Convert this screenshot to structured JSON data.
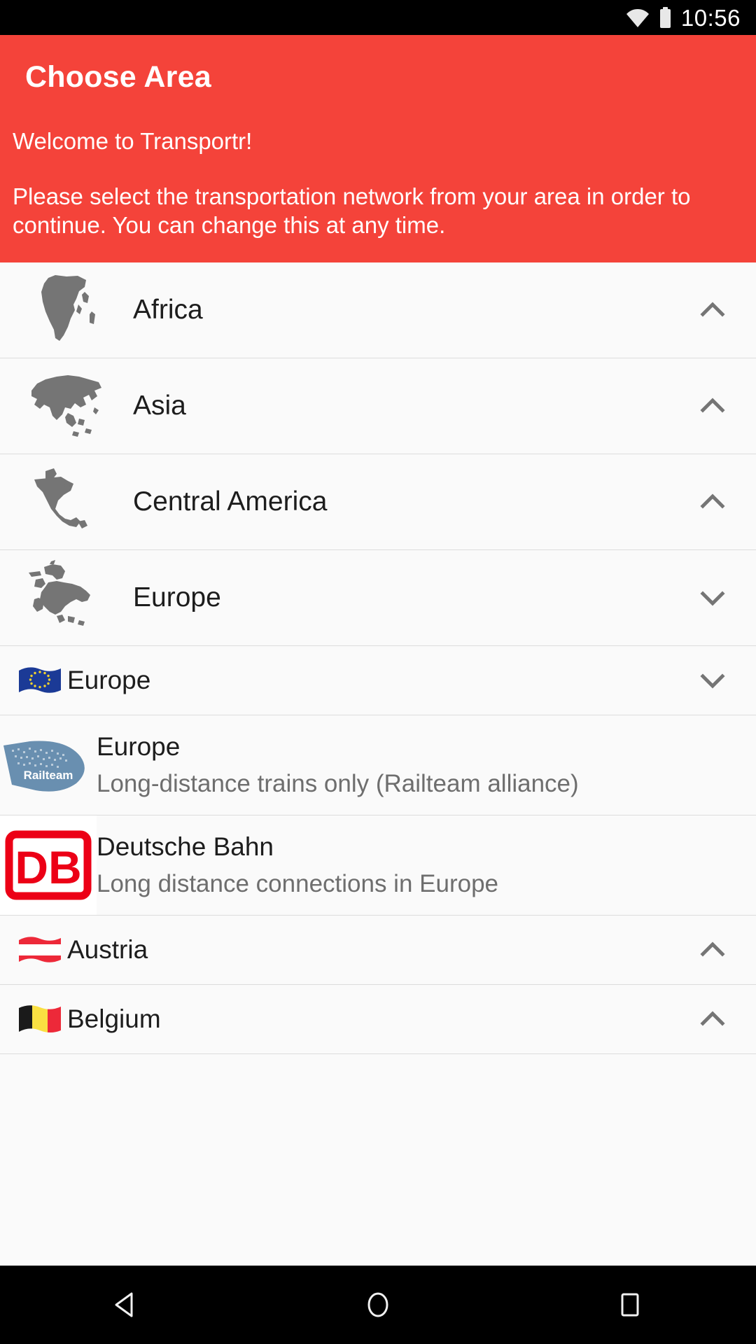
{
  "statusbar": {
    "time": "10:56",
    "icons": [
      "wifi-icon",
      "battery-icon"
    ]
  },
  "header": {
    "title": "Choose Area",
    "welcome": "Welcome to Transportr!",
    "instructions": "Please select the transportation network from your area in order to continue. You can change this at any time.",
    "background_color": "#f4433a",
    "text_color": "#ffffff"
  },
  "list": {
    "rows": [
      {
        "kind": "continent",
        "icon": "africa-map-icon",
        "label": "Africa",
        "chevron": "chevron-up-icon"
      },
      {
        "kind": "continent",
        "icon": "asia-map-icon",
        "label": "Asia",
        "chevron": "chevron-up-icon"
      },
      {
        "kind": "continent",
        "icon": "central-america-map-icon",
        "label": "Central America",
        "chevron": "chevron-up-icon"
      },
      {
        "kind": "continent",
        "icon": "europe-map-icon",
        "label": "Europe",
        "chevron": "chevron-down-icon"
      },
      {
        "kind": "country",
        "icon": "flag-european-union-icon",
        "label": "Europe",
        "chevron": "chevron-down-icon"
      },
      {
        "kind": "provider",
        "icon": "railteam-logo",
        "name": "Europe",
        "desc": "Long-distance trains only (Railteam alliance)"
      },
      {
        "kind": "provider",
        "icon": "deutsche-bahn-logo",
        "name": "Deutsche Bahn",
        "desc": "Long distance connections in Europe"
      },
      {
        "kind": "country",
        "icon": "flag-austria-icon",
        "label": "Austria",
        "chevron": "chevron-up-icon"
      },
      {
        "kind": "country",
        "icon": "flag-belgium-icon",
        "label": "Belgium",
        "chevron": "chevron-up-icon"
      }
    ]
  },
  "navbar": {
    "back_label": "back-button",
    "home_label": "home-button",
    "recents_label": "recents-button"
  },
  "colors": {
    "accent_red": "#f4433a",
    "list_background": "#fafafa",
    "divider": "#dcdcdc",
    "continent_icon": "#757575",
    "secondary_text": "#6e6e6e",
    "db_red": "#ec0016",
    "railteam_blue": "#5f85a8",
    "eu_blue": "#1b3a96",
    "eu_star": "#f2d22e",
    "austria_red": "#ed2939",
    "belgium_yellow": "#fae042"
  }
}
